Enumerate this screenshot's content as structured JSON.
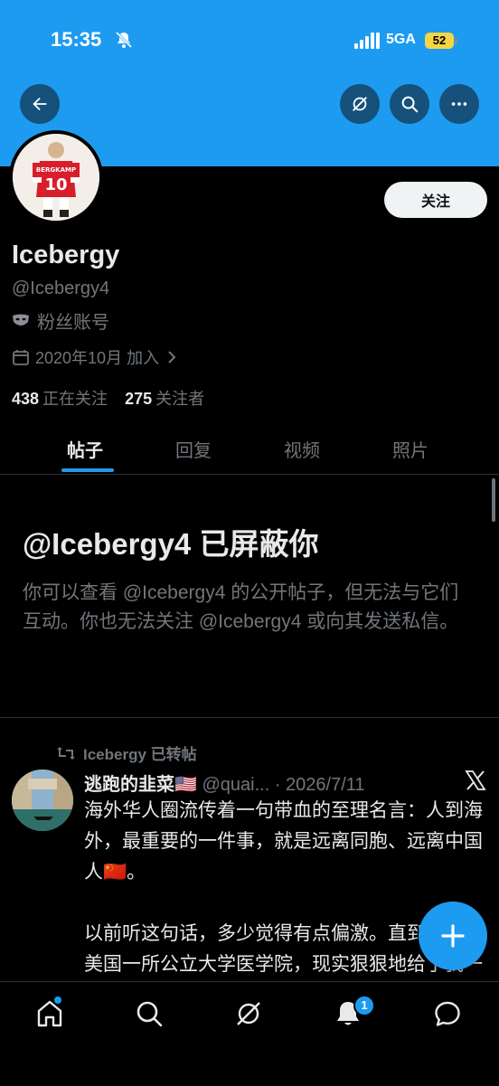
{
  "status_bar": {
    "time": "15:35",
    "network": "5GA",
    "battery": "52"
  },
  "header": {
    "back_icon": "arrow-left-icon",
    "grok_icon": "grok-icon",
    "search_icon": "search-icon",
    "more_icon": "more-horizontal-icon",
    "banner_color": "#1d9bf0"
  },
  "profile": {
    "display_name": "Icebergy",
    "handle": "@Icebergy4",
    "label": "粉丝账号",
    "joined": "2020年10月 加入",
    "following_count": "438",
    "following_label": "正在关注",
    "followers_count": "275",
    "followers_label": "关注者",
    "follow_button": "关注",
    "avatar_text": "BERGKAMP",
    "avatar_number": "10"
  },
  "tabs": [
    "帖子",
    "回复",
    "视频",
    "照片"
  ],
  "blocked": {
    "title": "@Icebergy4 已屏蔽你",
    "body": "你可以查看 @Icebergy4 的公开帖子，但无法与它们互动。你也无法关注 @Icebergy4 或向其发送私信。"
  },
  "post": {
    "retweet_label": "Icebergy 已转帖",
    "author_name": "逃跑的韭菜🇺🇸",
    "author_meta": " @quai... · 2026/7/11",
    "text_p1": "海外华人圈流传着一句带血的至理名言：人到海外，最重要的一件事，就是远离同胞、远离中国人🇨🇳。",
    "text_p2": "以前听这句话，多少觉得有点偏激。直到我入职美国一所公立大学医学院，现实狠狠地给了我一记耳光。"
  },
  "fab_icon": "compose-plus-icon",
  "bottom_nav": {
    "items": [
      "home-icon",
      "search-icon",
      "grok-icon",
      "notifications-icon",
      "messages-icon"
    ],
    "notif_badge": "1"
  }
}
